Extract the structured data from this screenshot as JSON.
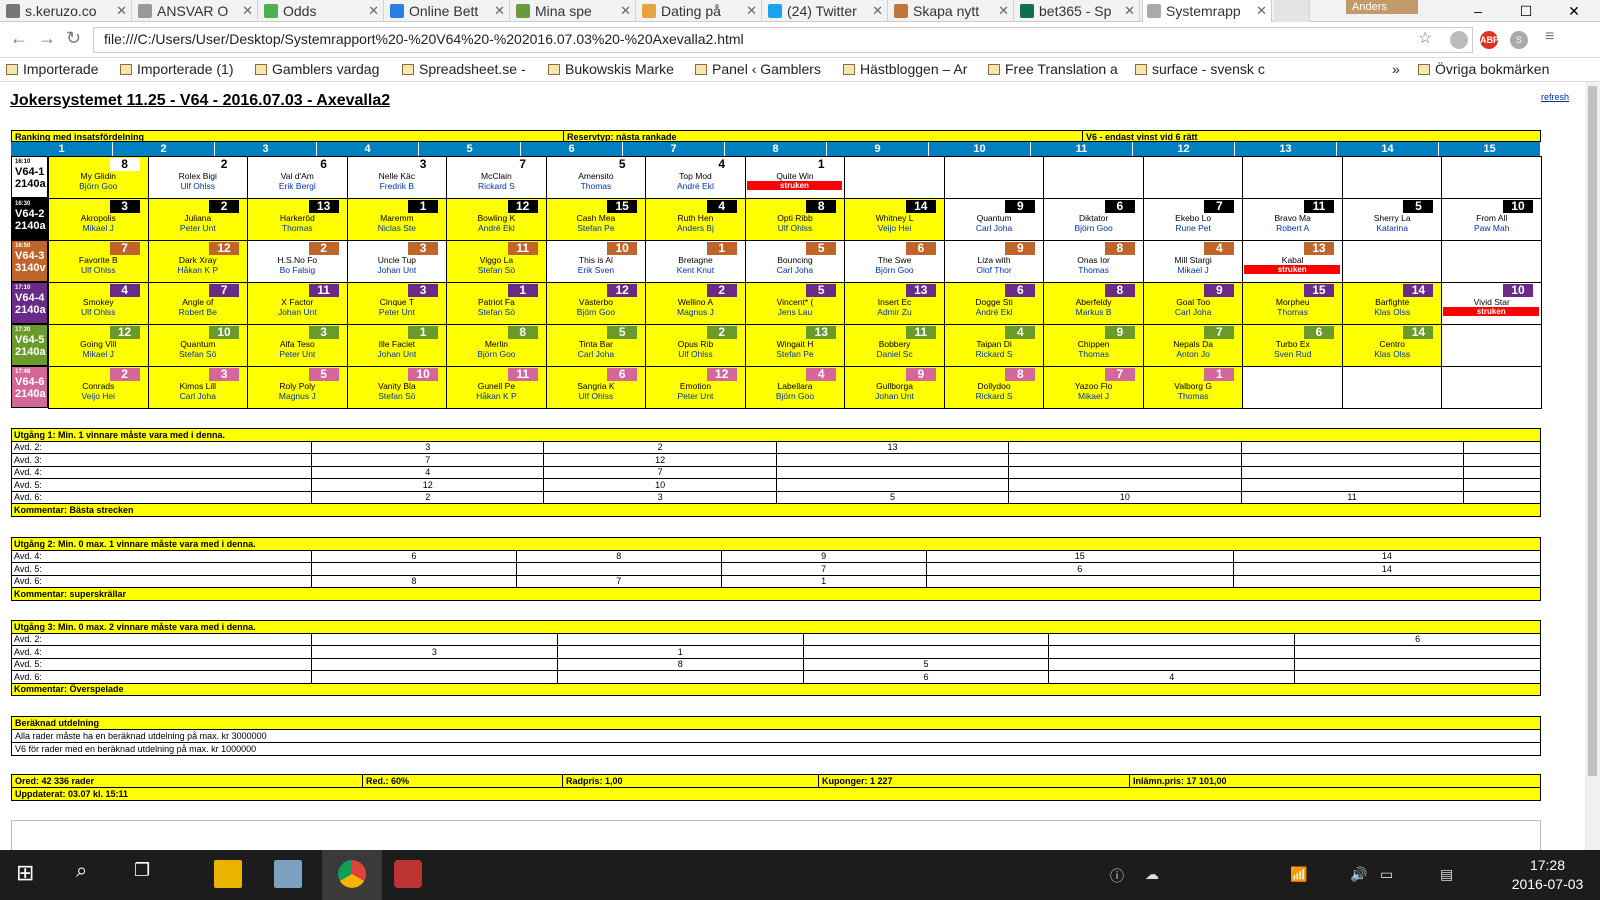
{
  "browser": {
    "tabs": [
      {
        "label": "s.keruzo.co",
        "color": "#777"
      },
      {
        "label": "ANSVAR O",
        "color": "#999"
      },
      {
        "label": "Odds",
        "color": "#4caf50"
      },
      {
        "label": "Online Bett",
        "color": "#2a7de1"
      },
      {
        "label": "Mina spe",
        "color": "#6a9b3a"
      },
      {
        "label": "Dating på",
        "color": "#e8a33c"
      },
      {
        "label": "(24) Twitter",
        "color": "#1da1f2"
      },
      {
        "label": "Skapa nytt",
        "color": "#c0753a"
      },
      {
        "label": "bet365 - Sp",
        "color": "#126e51"
      },
      {
        "label": "Systemrapp",
        "color": "#aaa"
      }
    ],
    "user": "Anders",
    "url": "file:///C:/Users/User/Desktop/Systemrapport%20-%20V64%20-%202016.07.03%20-%20Axevalla2.html",
    "bookmarks": [
      "Importerade",
      "Importerade (1)",
      "Gamblers vardag",
      "Spreadsheet.se -",
      "Bukowskis Marke",
      "Panel ‹ Gamblers",
      "Hästbloggen – Ar",
      "Free Translation a",
      "surface - svensk c",
      "»",
      "Övriga bokmärken"
    ]
  },
  "report": {
    "title": "Jokersystemet 11.25 - V64 - 2016.07.03 - Axevalla2",
    "refresh": "refresh",
    "hdr_ranking": "Ranking med insatsfördelning",
    "hdr_reserv": "Reservtyp: nästa rankade",
    "hdr_v6": "V6 - endast vinst vid 6 rätt",
    "columns": [
      "1",
      "2",
      "3",
      "4",
      "5",
      "6",
      "7",
      "8",
      "9",
      "10",
      "11",
      "12",
      "13",
      "14",
      "15"
    ],
    "races": [
      {
        "time": "16:10",
        "label": "V64-1",
        "dist": "2140a",
        "color": "#fff",
        "textcolor": "#000",
        "badgecolor": "#fff",
        "badgetext": "#000",
        "horses": [
          [
            "8",
            "My Glidin",
            "Björn Goo",
            "y"
          ],
          [
            "2",
            "Rolex Bigi",
            "Ulf Ohlss",
            "w"
          ],
          [
            "6",
            "Val d'Am",
            "Erik Bergl",
            "w"
          ],
          [
            "3",
            "Nelle Käc",
            "Fredrik B",
            "w"
          ],
          [
            "7",
            "McClain",
            "Rickard S",
            "w"
          ],
          [
            "5",
            "Amensito",
            "Thomas",
            "w"
          ],
          [
            "4",
            "Top Mod",
            "André Ekl",
            "w"
          ],
          [
            "1",
            "Quite Win",
            "struken",
            "w"
          ]
        ]
      },
      {
        "time": "16:30",
        "label": "V64-2",
        "dist": "2140a",
        "color": "#000",
        "textcolor": "#fff",
        "badgecolor": "#000",
        "badgetext": "#fff",
        "horses": [
          [
            "3",
            "Akropolis",
            "Mikael J",
            "y"
          ],
          [
            "2",
            "Juliana",
            "Peter Unt",
            "y"
          ],
          [
            "13",
            "Harkeröd",
            "Thomas",
            "y"
          ],
          [
            "1",
            "Maremm",
            "Niclas Ste",
            "y"
          ],
          [
            "12",
            "Bowling K",
            "André Ekl",
            "y"
          ],
          [
            "15",
            "Cash Mea",
            "Stefan Pe",
            "y"
          ],
          [
            "4",
            "Ruth Hen",
            "Anders Bj",
            "y"
          ],
          [
            "8",
            "Opti Ribb",
            "Ulf Ohlss",
            "y"
          ],
          [
            "14",
            "Whitney L",
            "Veijo Hei",
            "y"
          ],
          [
            "9",
            "Quantum",
            "Carl Joha",
            "w"
          ],
          [
            "6",
            "Diktator",
            "Björn Goo",
            "w"
          ],
          [
            "7",
            "Ekebo Lo",
            "Rune Pet",
            "w"
          ],
          [
            "11",
            "Bravo Ma",
            "Robert A",
            "w"
          ],
          [
            "5",
            "Sherry La",
            "Katarina",
            "w"
          ],
          [
            "10",
            "From All",
            "Paw Mah",
            "w"
          ]
        ]
      },
      {
        "time": "16:50",
        "label": "V64-3",
        "dist": "3140v",
        "color": "#c0652a",
        "textcolor": "#fff",
        "badgecolor": "#c0652a",
        "badgetext": "#fff",
        "horses": [
          [
            "7",
            "Favorite B",
            "Ulf Ohlss",
            "y"
          ],
          [
            "12",
            "Dark Xray",
            "Håkan K P",
            "y"
          ],
          [
            "2",
            "H.S.No Fo",
            "Bo Falsig",
            "w"
          ],
          [
            "3",
            "Uncle Tup",
            "Johan Unt",
            "w"
          ],
          [
            "11",
            "Viggo La",
            "Stefan Sö",
            "y"
          ],
          [
            "10",
            "This is Al",
            "Erik Sven",
            "w"
          ],
          [
            "1",
            "Bretagne",
            "Kent Knut",
            "w"
          ],
          [
            "5",
            "Bouncing",
            "Carl Joha",
            "w"
          ],
          [
            "6",
            "The Swe",
            "Björn Goo",
            "w"
          ],
          [
            "9",
            "Liza with",
            "Olof Thor",
            "w"
          ],
          [
            "8",
            "Onas Ior",
            "Thomas",
            "w"
          ],
          [
            "4",
            "Mill Stargi",
            "Mikael J",
            "w"
          ],
          [
            "13",
            "Kabal",
            "struken",
            "w"
          ]
        ]
      },
      {
        "time": "17:10",
        "label": "V64-4",
        "dist": "2140a",
        "color": "#6a2a8a",
        "textcolor": "#fff",
        "badgecolor": "#6a2a8a",
        "badgetext": "#fff",
        "horses": [
          [
            "4",
            "Smokey",
            "Ulf Ohlss",
            "y"
          ],
          [
            "7",
            "Angle of",
            "Robert Be",
            "y"
          ],
          [
            "11",
            "X Factor",
            "Johan Unt",
            "y"
          ],
          [
            "3",
            "Cinque T",
            "Peter Unt",
            "y"
          ],
          [
            "1",
            "Patriot Fa",
            "Stefan Sö",
            "y"
          ],
          [
            "12",
            "Västerbo",
            "Björn Goo",
            "y"
          ],
          [
            "2",
            "Wellino A",
            "Magnus J",
            "y"
          ],
          [
            "5",
            "Vincent* (",
            "Jens Lau",
            "y"
          ],
          [
            "13",
            "Insert Ec",
            "Admir Zu",
            "y"
          ],
          [
            "6",
            "Dogge Sti",
            "André Ekl",
            "y"
          ],
          [
            "8",
            "Aberfeldy",
            "Markus B",
            "y"
          ],
          [
            "9",
            "Goal Too",
            "Carl Joha",
            "y"
          ],
          [
            "15",
            "Morpheu",
            "Thomas",
            "y"
          ],
          [
            "14",
            "Barfighte",
            "Klas Olss",
            "y"
          ],
          [
            "10",
            "Vivid Star",
            "struken",
            "w"
          ]
        ]
      },
      {
        "time": "17:30",
        "label": "V64-5",
        "dist": "2140a",
        "color": "#6a9a2a",
        "textcolor": "#fff",
        "badgecolor": "#6a9a2a",
        "badgetext": "#fff",
        "horses": [
          [
            "12",
            "Going Vill",
            "Mikael J",
            "y"
          ],
          [
            "10",
            "Quantum",
            "Stefan Sö",
            "y"
          ],
          [
            "3",
            "Alfa Teso",
            "Peter Unt",
            "y"
          ],
          [
            "1",
            "Ille Faciet",
            "Johan Unt",
            "y"
          ],
          [
            "8",
            "Merlin",
            "Björn Goo",
            "y"
          ],
          [
            "5",
            "Tinta Bar",
            "Carl Joha",
            "y"
          ],
          [
            "2",
            "Opus Rib",
            "Ulf Ohlss",
            "y"
          ],
          [
            "13",
            "Wingait H",
            "Stefan Pe",
            "y"
          ],
          [
            "11",
            "Bobbery",
            "Daniel Sc",
            "y"
          ],
          [
            "4",
            "Taipan Di",
            "Rickard S",
            "y"
          ],
          [
            "9",
            "Chippen",
            "Thomas",
            "y"
          ],
          [
            "7",
            "Nepals Da",
            "Anton Jo",
            "y"
          ],
          [
            "6",
            "Turbo Ex",
            "Sven Rud",
            "y"
          ],
          [
            "14",
            "Centro",
            "Klas Olss",
            "y"
          ]
        ]
      },
      {
        "time": "17:48",
        "label": "V64-6",
        "dist": "2140a",
        "color": "#d4679a",
        "textcolor": "#fff",
        "badgecolor": "#d4679a",
        "badgetext": "#fff",
        "horses": [
          [
            "2",
            "Conrads",
            "Veijo Hei",
            "y"
          ],
          [
            "3",
            "Kimos Lill",
            "Carl Joha",
            "y"
          ],
          [
            "5",
            "Roly Poly",
            "Magnus J",
            "y"
          ],
          [
            "10",
            "Vanity Bla",
            "Stefan Sö",
            "y"
          ],
          [
            "11",
            "Gunell Pe",
            "Håkan K P",
            "y"
          ],
          [
            "6",
            "Sangria K",
            "Ulf Ohlss",
            "y"
          ],
          [
            "12",
            "Emotion",
            "Peter Unt",
            "y"
          ],
          [
            "4",
            "Labellara",
            "Björn Goo",
            "y"
          ],
          [
            "9",
            "Gullborga",
            "Johan Unt",
            "y"
          ],
          [
            "8",
            "Dollydoo",
            "Rickard S",
            "y"
          ],
          [
            "7",
            "Yazoo Flo",
            "Mikael J",
            "y"
          ],
          [
            "1",
            "Valborg G",
            "Thomas",
            "y"
          ]
        ]
      }
    ],
    "utgang1": {
      "header": "Utgång 1: Min. 1 vinnare måste vara med i denna.",
      "rows": [
        {
          "label": "Avd. 2:",
          "vals": [
            "3",
            "2",
            "13",
            "",
            "",
            ""
          ]
        },
        {
          "label": "Avd. 3:",
          "vals": [
            "7",
            "12",
            "",
            "",
            "",
            ""
          ]
        },
        {
          "label": "Avd. 4:",
          "vals": [
            "4",
            "7",
            "",
            "",
            "",
            ""
          ]
        },
        {
          "label": "Avd. 5:",
          "vals": [
            "12",
            "10",
            "",
            "",
            "",
            ""
          ]
        },
        {
          "label": "Avd. 6:",
          "vals": [
            "2",
            "3",
            "5",
            "10",
            "11",
            ""
          ]
        }
      ],
      "comment": "Kommentar: Bästa strecken"
    },
    "utgang2": {
      "header": "Utgång 2: Min. 0 max. 1 vinnare måste vara med i denna.",
      "rows": [
        {
          "label": "Avd. 4:",
          "vals": [
            "6",
            "8",
            "9",
            "15",
            "14"
          ]
        },
        {
          "label": "Avd. 5:",
          "vals": [
            "",
            "",
            "7",
            "6",
            "14"
          ]
        },
        {
          "label": "Avd. 6:",
          "vals": [
            "8",
            "7",
            "1",
            "",
            ""
          ]
        }
      ],
      "comment": "Kommentar: superskrällar"
    },
    "utgang3": {
      "header": "Utgång 3: Min. 0 max. 2 vinnare måste vara med i denna.",
      "rows": [
        {
          "label": "Avd. 2:",
          "vals": [
            "",
            "",
            "",
            "",
            "6"
          ]
        },
        {
          "label": "Avd. 4:",
          "vals": [
            "3",
            "1",
            "",
            "",
            ""
          ]
        },
        {
          "label": "Avd. 5:",
          "vals": [
            "",
            "8",
            "5",
            "",
            ""
          ]
        },
        {
          "label": "Avd. 6:",
          "vals": [
            "",
            "",
            "6",
            "4",
            ""
          ]
        }
      ],
      "comment": "Kommentar: Överspelade"
    },
    "utdelning": {
      "header": "Beräknad utdelning",
      "line1": "Alla rader måste ha en beräknad utdelning på max. kr 3000000",
      "line2": "V6 för rader med en beräknad utdelning på max. kr 1000000"
    },
    "summary": {
      "ored": "Ored: 42 336 rader",
      "red": "Red.: 60%",
      "radpris": "Radpris: 1,00",
      "kuponger": "Kuponger: 1 227",
      "inlamn": "Inlämn.pris: 17 101,00",
      "updated": "Uppdaterat: 03.07 kl. 15:11"
    }
  },
  "taskbar": {
    "time": "17:28",
    "date": "2016-07-03"
  }
}
